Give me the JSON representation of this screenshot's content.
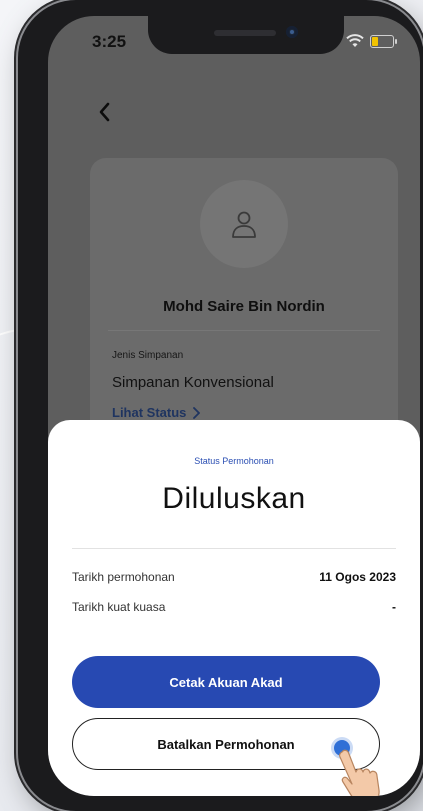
{
  "status_bar": {
    "time": "3:25"
  },
  "account": {
    "name": "Mohd Saire Bin Nordin",
    "deposit_type_label": "Jenis Simpanan",
    "deposit_type_value": "Simpanan Konvensional",
    "status_link": "Lihat Status"
  },
  "sheet": {
    "caption": "Status Permohonan",
    "title": "Diluluskan",
    "rows": [
      {
        "label": "Tarikh permohonan",
        "value": "11 Ogos 2023"
      },
      {
        "label": "Tarikh kuat kuasa",
        "value": "-"
      }
    ],
    "primary_button": "Cetak Akuan Akad",
    "secondary_button": "Batalkan Permohonan"
  },
  "colors": {
    "accent": "#2749b2",
    "overlay": "#5e5e5e",
    "link": "#1f3460"
  },
  "icons": [
    "back-icon",
    "user-icon",
    "chevron-right-icon",
    "wifi-icon",
    "battery-icon",
    "pointer-hand-icon"
  ]
}
